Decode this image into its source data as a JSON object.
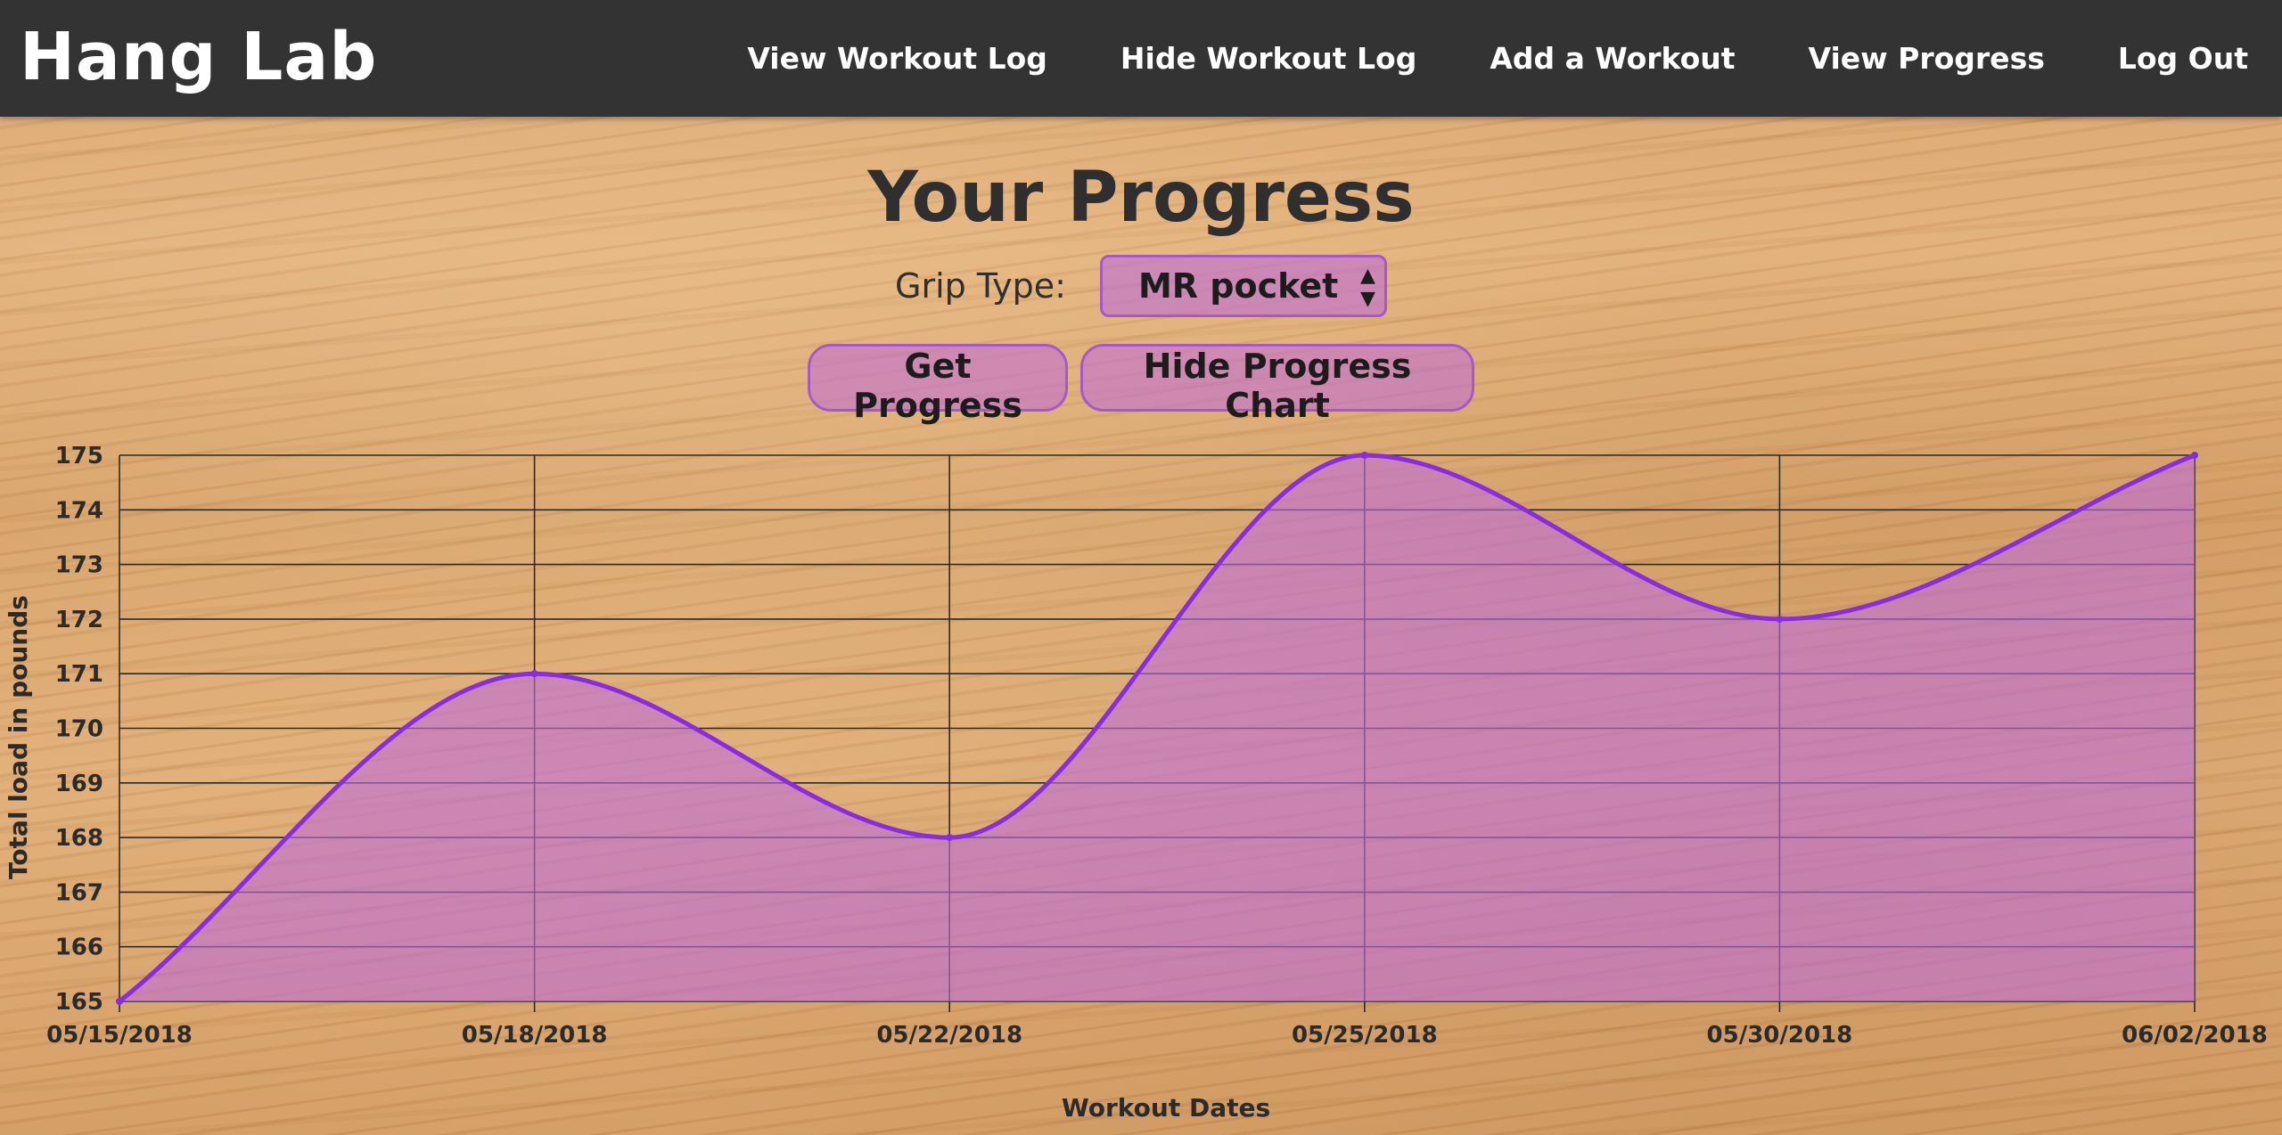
{
  "nav": {
    "brand": "Hang Lab",
    "links": [
      "View Workout Log",
      "Hide Workout Log",
      "Add a Workout",
      "View Progress",
      "Log Out"
    ]
  },
  "page": {
    "title": "Your Progress"
  },
  "form": {
    "grip_label": "Grip Type:",
    "grip_value": "MR pocket",
    "get_progress_label": "Get Progress",
    "hide_chart_label": "Hide Progress Chart"
  },
  "colors": {
    "navbar": "#333333",
    "accent": "#8a2be2",
    "fill": "#bf6dd6",
    "button_border": "#a657c8"
  },
  "icons": {
    "select_arrows": "updown-arrows-icon"
  },
  "chart_data": {
    "type": "area",
    "x": [
      "05/15/2018",
      "05/18/2018",
      "05/22/2018",
      "05/25/2018",
      "05/30/2018",
      "06/02/2018"
    ],
    "y": [
      165,
      171,
      168,
      175,
      172,
      175
    ],
    "xlabel": "Workout Dates",
    "ylabel": "Total load in pounds",
    "ylim": [
      165,
      175
    ],
    "yticks": [
      165,
      166,
      167,
      168,
      169,
      170,
      171,
      172,
      173,
      174,
      175
    ],
    "grid": true,
    "curve": "smooth"
  }
}
